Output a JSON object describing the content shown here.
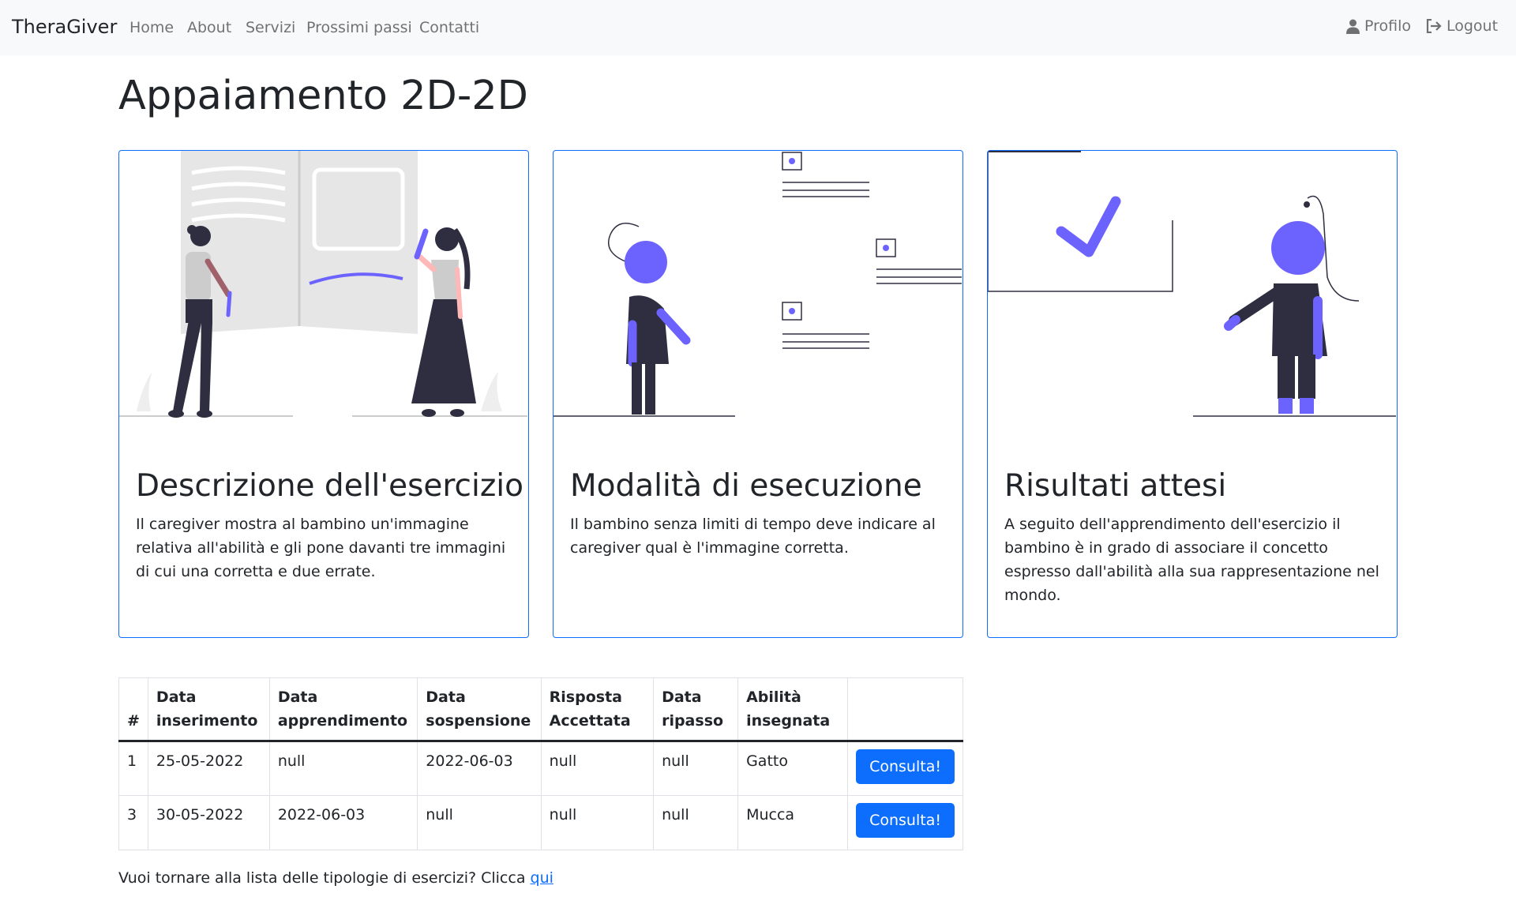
{
  "nav": {
    "brand": "TheraGiver",
    "links": [
      "Home",
      "About",
      "Servizi",
      "Prossimi passi",
      "Contatti"
    ],
    "profile": "Profilo",
    "logout": "Logout"
  },
  "page": {
    "title": "Appaiamento 2D-2D"
  },
  "cards": [
    {
      "title": "Descrizione dell'esercizio",
      "text": "Il caregiver mostra al bambino un'immagine relativa all'abilità e gli pone davanti tre immagini di cui una corretta e due errate.",
      "illustration": "two-women-open-book-illustration"
    },
    {
      "title": "Modalità di esecuzione",
      "text": "Il bambino senza limiti di tempo deve indicare al caregiver qual è l'immagine corretta.",
      "illustration": "person-choosing-options-illustration"
    },
    {
      "title": "Risultati attesi",
      "text": "A seguito dell'apprendimento dell'esercizio il bambino è in grado di associare il concetto espresso dall'abilità alla sua rappresentazione nel mondo.",
      "illustration": "person-checkmark-board-illustration"
    }
  ],
  "table": {
    "headers": [
      "#",
      "Data inserimento",
      "Data apprendimento",
      "Data sospensione",
      "Risposta Accettata",
      "Data ripasso",
      "Abilità insegnata",
      ""
    ],
    "rows": [
      {
        "id": "1",
        "inserimento": "25-05-2022",
        "apprendimento": "null",
        "sospensione": "2022-06-03",
        "risposta": "null",
        "ripasso": "null",
        "abilita": "Gatto",
        "action": "Consulta!"
      },
      {
        "id": "3",
        "inserimento": "30-05-2022",
        "apprendimento": "2022-06-03",
        "sospensione": "null",
        "risposta": "null",
        "ripasso": "null",
        "abilita": "Mucca",
        "action": "Consulta!"
      }
    ]
  },
  "footer": {
    "back_text": "Vuoi tornare alla lista delle tipologie di esercizi? Clicca",
    "back_link": "qui"
  },
  "colors": {
    "accent": "#6c63ff",
    "primary": "#0d6efd",
    "dark": "#2f2e41",
    "navbar_bg": "#f8f9fa"
  }
}
